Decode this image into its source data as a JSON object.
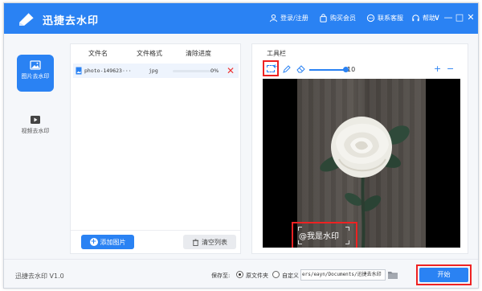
{
  "app": {
    "title": "迅捷去水印",
    "version": "迅捷去水印 V1.0"
  },
  "titlebar": {
    "login": "登录/注册",
    "buy_member": "购买会员",
    "contact": "联系客服",
    "help": "帮助",
    "controls": [
      "∨",
      "—",
      "□",
      "✕"
    ]
  },
  "sidebar": {
    "items": [
      {
        "label": "图片去水印",
        "active": true,
        "icon": "image-icon"
      },
      {
        "label": "视频去水印",
        "active": false,
        "icon": "video-icon"
      }
    ]
  },
  "file_list": {
    "columns": [
      "文件名",
      "文件格式",
      "清除进度"
    ],
    "rows": [
      {
        "name": "photo-149623···",
        "format": "jpg",
        "progress": 0,
        "progress_label": "0%"
      }
    ],
    "add_button": "添加图片",
    "clear_button": "清空列表"
  },
  "toolbar": {
    "label": "工具栏",
    "brush_size": "10",
    "zoom_in": "+",
    "zoom_out": "−"
  },
  "preview": {
    "watermark_text": "@我是水印"
  },
  "bottom": {
    "save_label": "保存至:",
    "option_original": "原文件夹",
    "option_custom": "自定义",
    "path": "ers/eayn/Documents/迅捷去水印",
    "start_button": "开始"
  },
  "colors": {
    "accent": "#2a82f3",
    "highlight": "#e22222"
  }
}
